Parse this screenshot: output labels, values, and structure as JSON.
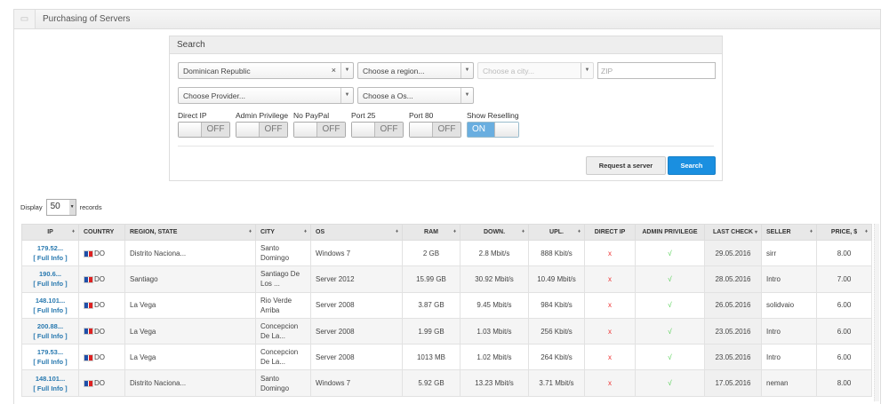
{
  "panel": {
    "title": "Purchasing of Servers"
  },
  "search": {
    "title": "Search",
    "country": "Dominican Republic",
    "region": "Choose a region...",
    "city": "Choose a city...",
    "zip": "ZIP",
    "provider": "Choose Provider...",
    "os": "Choose a Os...",
    "toggles": [
      {
        "label": "Direct IP",
        "state": "OFF"
      },
      {
        "label": "Admin Privilege",
        "state": "OFF"
      },
      {
        "label": "No PayPal",
        "state": "OFF"
      },
      {
        "label": "Port 25",
        "state": "OFF"
      },
      {
        "label": "Port 80",
        "state": "OFF"
      },
      {
        "label": "Show Reselling",
        "state": "ON"
      }
    ],
    "request_label": "Request a server",
    "search_label": "Search"
  },
  "display": {
    "prefix": "Display",
    "value": "50",
    "suffix": "records"
  },
  "table": {
    "columns": [
      "IP",
      "COUNTRY",
      "REGION, STATE",
      "CITY",
      "OS",
      "RAM",
      "DOWN.",
      "UPL.",
      "DIRECT IP",
      "ADMIN PRIVILEGE",
      "LAST CHECK",
      "SELLER",
      "PRICE, $"
    ],
    "full_info": "[ Full Info ]",
    "rows": [
      [
        "179.52...",
        "DO",
        "Distrito Naciona...",
        "Santo Domingo",
        "Windows 7",
        "2 GB",
        "2.8 Mbit/s",
        "888 Kbit/s",
        "x",
        "√",
        "29.05.2016",
        "sirr",
        "8.00"
      ],
      [
        "190.6...",
        "DO",
        "Santiago",
        "Santiago De Los ...",
        "Server 2012",
        "15.99 GB",
        "30.92 Mbit/s",
        "10.49 Mbit/s",
        "x",
        "√",
        "28.05.2016",
        "Intro",
        "7.00"
      ],
      [
        "148.101...",
        "DO",
        "La Vega",
        "Rio Verde Arriba",
        "Server 2008",
        "3.87 GB",
        "9.45 Mbit/s",
        "984 Kbit/s",
        "x",
        "√",
        "26.05.2016",
        "solidvaio",
        "6.00"
      ],
      [
        "200.88...",
        "DO",
        "La Vega",
        "Concepcion De La...",
        "Server 2008",
        "1.99 GB",
        "1.03 Mbit/s",
        "256 Kbit/s",
        "x",
        "√",
        "23.05.2016",
        "Intro",
        "6.00"
      ],
      [
        "179.53...",
        "DO",
        "La Vega",
        "Concepcion De La...",
        "Server 2008",
        "1013 MB",
        "1.02 Mbit/s",
        "264 Kbit/s",
        "x",
        "√",
        "23.05.2016",
        "Intro",
        "6.00"
      ],
      [
        "148.101...",
        "DO",
        "Distrito Naciona...",
        "Santo Domingo",
        "Windows 7",
        "5.92 GB",
        "13.23 Mbit/s",
        "3.71 Mbit/s",
        "x",
        "√",
        "17.05.2016",
        "neman",
        "8.00"
      ]
    ]
  }
}
